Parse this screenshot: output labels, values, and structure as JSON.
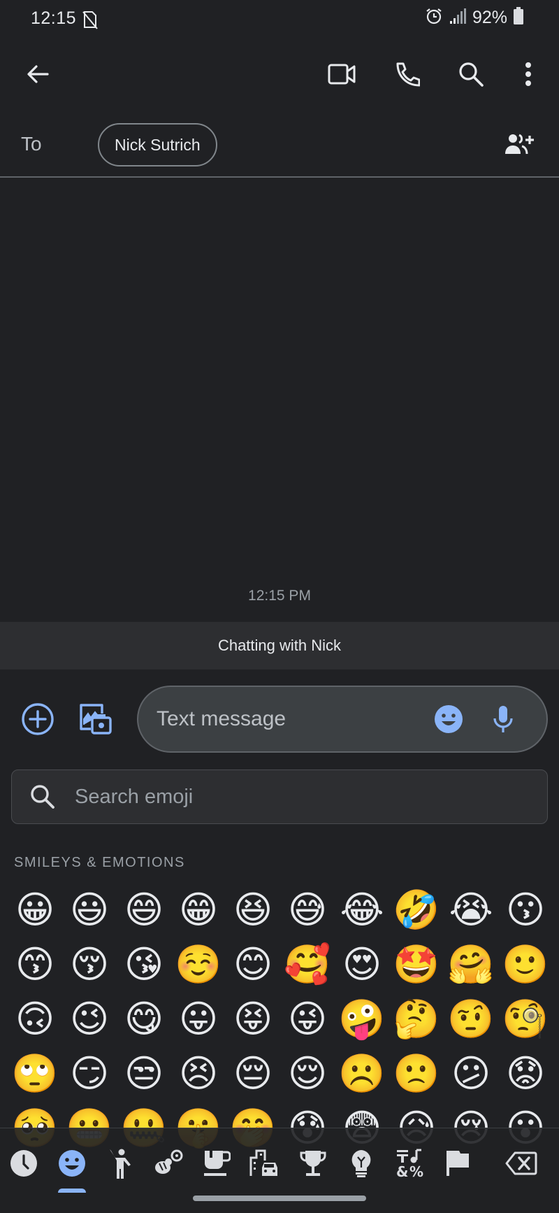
{
  "status_bar": {
    "time": "12:15",
    "battery_percent": "92%",
    "icons": [
      "do-not-disturb-off-icon",
      "alarm-icon",
      "signal-icon",
      "battery-icon"
    ]
  },
  "app_bar": {
    "actions": [
      "back",
      "video-call",
      "phone-call",
      "search",
      "more-options"
    ]
  },
  "recipients": {
    "to_label": "To",
    "chips": [
      "Nick Sutrich"
    ],
    "add_people_icon": "add-person-icon"
  },
  "conversation": {
    "timestamp": "12:15 PM",
    "banner": "Chatting with Nick"
  },
  "compose": {
    "placeholder": "Text message",
    "value": ""
  },
  "emoji_picker": {
    "search_placeholder": "Search emoji",
    "section_title": "SMILEYS & EMOTIONS",
    "rows": [
      [
        "😀",
        "😃",
        "😄",
        "😁",
        "😆",
        "😅",
        "😂",
        "🤣",
        "😭",
        "😗"
      ],
      [
        "😙",
        "😚",
        "😘",
        "☺️",
        "😊",
        "🥰",
        "😍",
        "🤩",
        "🤗",
        "🙂"
      ],
      [
        "🙃",
        "😉",
        "😋",
        "😛",
        "😝",
        "😜",
        "🤪",
        "🤔",
        "🤨",
        "🧐"
      ],
      [
        "🙄",
        "😏",
        "😒",
        "😣",
        "😔",
        "😌",
        "☹️",
        "🙁",
        "😕",
        "😟"
      ],
      [
        "🥺",
        "😬",
        "🤐",
        "🤫",
        "🤭",
        "😰",
        "😨",
        "😥",
        "😢",
        "😮"
      ]
    ],
    "categories": [
      {
        "name": "recent",
        "selected": false
      },
      {
        "name": "smileys-emotions",
        "selected": true
      },
      {
        "name": "people",
        "selected": false
      },
      {
        "name": "animals-nature",
        "selected": false
      },
      {
        "name": "food-drink",
        "selected": false
      },
      {
        "name": "travel-places",
        "selected": false
      },
      {
        "name": "activities",
        "selected": false
      },
      {
        "name": "objects",
        "selected": false
      },
      {
        "name": "symbols",
        "selected": false
      },
      {
        "name": "flags",
        "selected": false
      }
    ]
  },
  "colors": {
    "background": "#202124",
    "accent": "#8ab4f8",
    "banner": "#2d2e31",
    "compose_field": "#3c4043"
  }
}
